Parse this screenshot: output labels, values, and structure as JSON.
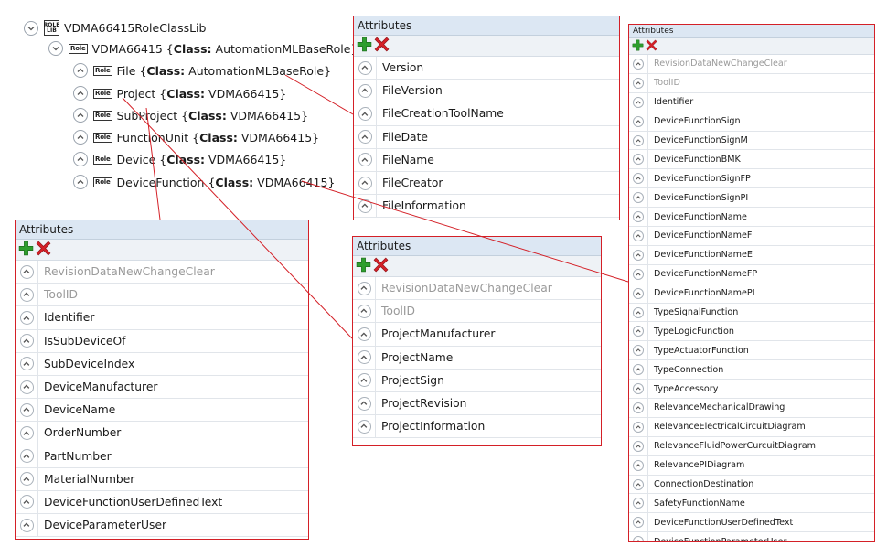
{
  "tree": {
    "library": {
      "name": "VDMA66415RoleClassLib",
      "badge": "ROLE LIB"
    },
    "root": {
      "name": "VDMA66415",
      "class_prefix": "Class:",
      "class": "AutomationMLBaseRole",
      "badge": "Role"
    },
    "children": [
      {
        "name": "File",
        "class": "AutomationMLBaseRole"
      },
      {
        "name": "Project",
        "class": "VDMA66415"
      },
      {
        "name": "SubProject",
        "class": "VDMA66415"
      },
      {
        "name": "FunctionUnit",
        "class": "VDMA66415"
      },
      {
        "name": "Device",
        "class": "VDMA66415"
      },
      {
        "name": "DeviceFunction",
        "class": "VDMA66415"
      }
    ]
  },
  "panels": {
    "file": {
      "title": "Attributes",
      "rows": [
        "Version",
        "FileVersion",
        "FileCreationToolName",
        "FileDate",
        "FileName",
        "FileCreator",
        "FileInformation"
      ],
      "greyed": []
    },
    "device": {
      "title": "Attributes",
      "rows": [
        "RevisionDataNewChangeClear",
        "ToolID",
        "Identifier",
        "IsSubDeviceOf",
        "SubDeviceIndex",
        "DeviceManufacturer",
        "DeviceName",
        "OrderNumber",
        "PartNumber",
        "MaterialNumber",
        "DeviceFunctionUserDefinedText",
        "DeviceParameterUser"
      ],
      "greyed": [
        0,
        1
      ]
    },
    "project": {
      "title": "Attributes",
      "rows": [
        "RevisionDataNewChangeClear",
        "ToolID",
        "ProjectManufacturer",
        "ProjectName",
        "ProjectSign",
        "ProjectRevision",
        "ProjectInformation"
      ],
      "greyed": [
        0,
        1
      ]
    },
    "devicefunction": {
      "title": "Attributes",
      "rows": [
        "RevisionDataNewChangeClear",
        "ToolID",
        "Identifier",
        "DeviceFunctionSign",
        "DeviceFunctionSignM",
        "DeviceFunctionBMK",
        "DeviceFunctionSignFP",
        "DeviceFunctionSignPI",
        "DeviceFunctionName",
        "DeviceFunctionNameF",
        "DeviceFunctionNameE",
        "DeviceFunctionNameFP",
        "DeviceFunctionNamePI",
        "TypeSignalFunction",
        "TypeLogicFunction",
        "TypeActuatorFunction",
        "TypeConnection",
        "TypeAccessory",
        "RelevanceMechanicalDrawing",
        "RelevanceElectricalCircuitDiagram",
        "RelevanceFluidPowerCurcuitDiagram",
        "RelevancePIDiagram",
        "ConnectionDestination",
        "SafetyFunctionName",
        "DeviceFunctionUserDefinedText",
        "DeviceFunctionParameterUser"
      ],
      "greyed": [
        0,
        1
      ]
    }
  },
  "colors": {
    "connector": "#d42027",
    "add": "#2e9e2e",
    "delete": "#d42027"
  }
}
